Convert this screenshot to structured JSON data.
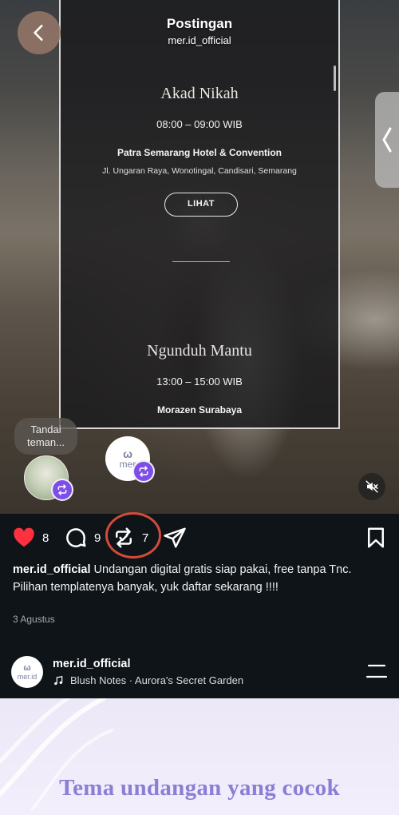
{
  "header": {
    "title": "Postingan",
    "subtitle": "mer.id_official"
  },
  "invitation": {
    "event1": {
      "name": "Akad Nikah",
      "time": "08:00 – 09:00 WIB",
      "venue": "Patra Semarang Hotel & Convention",
      "address": "Jl. Ungaran Raya, Wonotingal, Candisari, Semarang"
    },
    "button_label": "LIHAT",
    "event2": {
      "name": "Ngunduh Mantu",
      "time": "13:00 – 15:00 WIB",
      "venue": "Morazen Surabaya",
      "address": ""
    }
  },
  "tags": {
    "bubble_text": "Tandai teman...",
    "brand_logo_text": "mer"
  },
  "actions": {
    "like_count": "8",
    "comment_count": "9",
    "repost_count": "7"
  },
  "post": {
    "username": "mer.id_official",
    "caption": "Undangan digital gratis siap pakai, free tanpa Tnc.",
    "caption_line2": "Pilihan templatenya banyak, yuk daftar sekarang !!!!",
    "date": "3 Agustus"
  },
  "next_post": {
    "username": "mer.id_official",
    "avatar_text": "mer.id",
    "music": "Blush Notes · Aurora's Secret Garden",
    "headline": "Tema undangan yang cocok"
  },
  "colors": {
    "like": "#ff3040",
    "repost_badge": "#7d4ee6",
    "highlight_ring": "#d44b3c",
    "headline": "#8a7ed6"
  },
  "icons": [
    "chevron-left-icon",
    "chevron-left-icon",
    "repost-icon",
    "mute-icon",
    "heart-icon",
    "comment-icon",
    "repost-icon",
    "send-icon",
    "bookmark-icon",
    "music-note-icon",
    "menu-icon"
  ]
}
